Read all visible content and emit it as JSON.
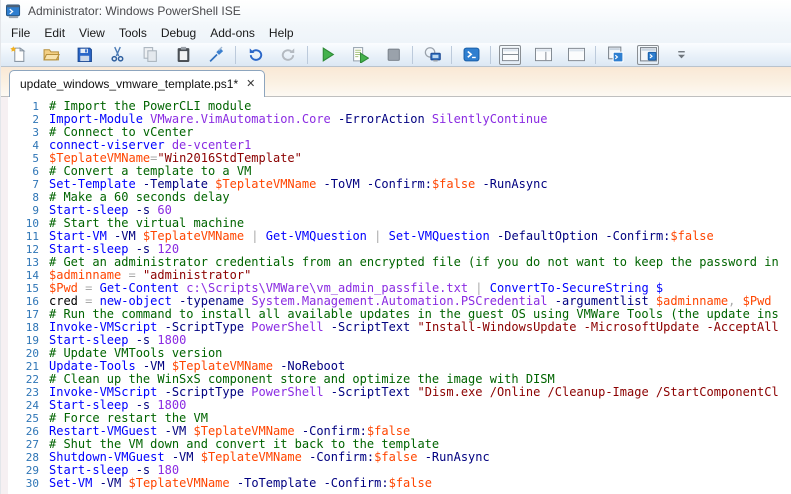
{
  "window": {
    "title": "Administrator: Windows PowerShell ISE"
  },
  "menu": {
    "items": [
      "File",
      "Edit",
      "View",
      "Tools",
      "Debug",
      "Add-ons",
      "Help"
    ]
  },
  "toolbar": {
    "buttons": [
      {
        "icon": "new-script-icon"
      },
      {
        "icon": "open-script-icon"
      },
      {
        "icon": "save-icon"
      },
      {
        "icon": "cut-icon"
      },
      {
        "icon": "copy-icon"
      },
      {
        "icon": "paste-icon"
      },
      {
        "icon": "clear-console-pane-icon"
      },
      {
        "separator": true
      },
      {
        "icon": "undo-icon"
      },
      {
        "icon": "redo-icon"
      },
      {
        "separator": true
      },
      {
        "icon": "run-script-icon"
      },
      {
        "icon": "run-selection-icon"
      },
      {
        "icon": "stop-operation-icon"
      },
      {
        "separator": true
      },
      {
        "icon": "new-remote-powershell-tab-icon"
      },
      {
        "separator": true
      },
      {
        "icon": "start-powershell-icon"
      },
      {
        "separator": true
      },
      {
        "icon": "show-script-pane-top-icon",
        "selected": true
      },
      {
        "icon": "show-script-pane-right-icon"
      },
      {
        "icon": "show-script-pane-maximized-icon"
      },
      {
        "separator": true
      },
      {
        "icon": "new-powershell-tab-icon"
      },
      {
        "icon": "show-script-pane-icon",
        "selected": true
      },
      {
        "icon": "toolbar-overflow-icon",
        "overflow": true
      }
    ]
  },
  "tab": {
    "label": "update_windows_vmware_template.ps1*",
    "close_glyph": "✕"
  },
  "editor": {
    "line_number_color": "#2E75B6",
    "token_colors": {
      "c": "#006400",
      "k": "#0000FF",
      "p": "#000080",
      "a": "#8A2BE2",
      "v": "#FF4500",
      "s": "#8B0000",
      "o": "#A9A9A9",
      "t": "#000000"
    },
    "lines": [
      {
        "n": 1,
        "t": [
          [
            "c",
            "# Import the PowerCLI module"
          ]
        ]
      },
      {
        "n": 2,
        "t": [
          [
            "k",
            "Import-Module"
          ],
          [
            "a",
            " VMware.VimAutomation.Core"
          ],
          [
            "p",
            " -ErrorAction"
          ],
          [
            "a",
            " SilentlyContinue"
          ]
        ]
      },
      {
        "n": 3,
        "t": [
          [
            "c",
            "# Connect to vCenter"
          ]
        ]
      },
      {
        "n": 4,
        "t": [
          [
            "k",
            "connect-viserver"
          ],
          [
            "a",
            " de-vcenter1"
          ]
        ]
      },
      {
        "n": 5,
        "t": [
          [
            "v",
            "$TeplateVMName"
          ],
          [
            "o",
            "="
          ],
          [
            "s",
            "\"Win2016StdTemplate\""
          ]
        ]
      },
      {
        "n": 6,
        "t": [
          [
            "c",
            "# Convert a template to a VM"
          ]
        ]
      },
      {
        "n": 7,
        "t": [
          [
            "k",
            "Set-Template"
          ],
          [
            "p",
            " -Template"
          ],
          [
            "v",
            " $TeplateVMName"
          ],
          [
            "p",
            " -ToVM"
          ],
          [
            "p",
            " -Confirm:"
          ],
          [
            "v",
            "$false"
          ],
          [
            "p",
            " -RunAsync"
          ]
        ]
      },
      {
        "n": 8,
        "t": [
          [
            "c",
            "# Make a 60 seconds delay"
          ]
        ]
      },
      {
        "n": 9,
        "t": [
          [
            "k",
            "Start-sleep"
          ],
          [
            "p",
            " -s"
          ],
          [
            "a",
            " 60"
          ]
        ]
      },
      {
        "n": 10,
        "t": [
          [
            "c",
            "# Start the virtual machine"
          ]
        ]
      },
      {
        "n": 11,
        "t": [
          [
            "k",
            "Start-VM"
          ],
          [
            "p",
            " -VM"
          ],
          [
            "v",
            " $TeplateVMName"
          ],
          [
            "o",
            " | "
          ],
          [
            "k",
            "Get-VMQuestion"
          ],
          [
            "o",
            " | "
          ],
          [
            "k",
            "Set-VMQuestion"
          ],
          [
            "p",
            " -DefaultOption"
          ],
          [
            "p",
            " -Confirm:"
          ],
          [
            "v",
            "$false"
          ]
        ]
      },
      {
        "n": 12,
        "t": [
          [
            "k",
            "Start-sleep"
          ],
          [
            "p",
            " -s"
          ],
          [
            "a",
            " 120"
          ]
        ]
      },
      {
        "n": 13,
        "t": [
          [
            "c",
            "# Get an administrator credentials from an encrypted file (if you do not want to keep the password in"
          ]
        ]
      },
      {
        "n": 14,
        "t": [
          [
            "v",
            "$adminname"
          ],
          [
            "o",
            " = "
          ],
          [
            "s",
            "\"administrator\""
          ]
        ]
      },
      {
        "n": 15,
        "t": [
          [
            "v",
            "$Pwd"
          ],
          [
            "o",
            " = "
          ],
          [
            "k",
            "Get-Content"
          ],
          [
            "a",
            " c:\\Scripts\\VMWare\\vm_admin_passfile.txt"
          ],
          [
            "o",
            " | "
          ],
          [
            "k",
            "ConvertTo-SecureString"
          ],
          [
            "k",
            " $"
          ]
        ]
      },
      {
        "n": 16,
        "t": [
          [
            "t",
            "cred"
          ],
          [
            "o",
            " = "
          ],
          [
            "k",
            "new-object"
          ],
          [
            "p",
            " -typename"
          ],
          [
            "a",
            " System.Management.Automation.PSCredential"
          ],
          [
            "p",
            " -argumentlist"
          ],
          [
            "v",
            " $adminname"
          ],
          [
            "o",
            ","
          ],
          [
            "v",
            " $Pwd"
          ]
        ]
      },
      {
        "n": 17,
        "t": [
          [
            "c",
            "# Run the command to install all available updates in the guest OS using VMWare Tools (the update ins"
          ]
        ]
      },
      {
        "n": 18,
        "t": [
          [
            "k",
            "Invoke-VMScript"
          ],
          [
            "p",
            " -ScriptType"
          ],
          [
            "a",
            " PowerShell"
          ],
          [
            "p",
            " -ScriptText"
          ],
          [
            "s",
            " \"Install-WindowsUpdate -MicrosoftUpdate -AcceptAll"
          ]
        ]
      },
      {
        "n": 19,
        "t": [
          [
            "k",
            "Start-sleep"
          ],
          [
            "p",
            " -s"
          ],
          [
            "a",
            " 1800"
          ]
        ]
      },
      {
        "n": 20,
        "t": [
          [
            "c",
            "# Update VMTools version"
          ]
        ]
      },
      {
        "n": 21,
        "t": [
          [
            "k",
            "Update-Tools"
          ],
          [
            "p",
            " -VM"
          ],
          [
            "v",
            " $TeplateVMName"
          ],
          [
            "p",
            " -NoReboot"
          ]
        ]
      },
      {
        "n": 22,
        "t": [
          [
            "c",
            "# Clean up the WinSxS component store and optimize the image with DISM"
          ]
        ]
      },
      {
        "n": 23,
        "t": [
          [
            "k",
            "Invoke-VMScript"
          ],
          [
            "p",
            " -ScriptType"
          ],
          [
            "a",
            " PowerShell"
          ],
          [
            "p",
            " -ScriptText"
          ],
          [
            "s",
            " \"Dism.exe /Online /Cleanup-Image /StartComponentCl"
          ]
        ]
      },
      {
        "n": 24,
        "t": [
          [
            "k",
            "Start-sleep"
          ],
          [
            "p",
            " -s"
          ],
          [
            "a",
            " 1800"
          ]
        ]
      },
      {
        "n": 25,
        "t": [
          [
            "c",
            "# Force restart the VM"
          ]
        ]
      },
      {
        "n": 26,
        "t": [
          [
            "k",
            "Restart-VMGuest"
          ],
          [
            "p",
            " -VM"
          ],
          [
            "v",
            " $TeplateVMName"
          ],
          [
            "p",
            " -Confirm:"
          ],
          [
            "v",
            "$false"
          ]
        ]
      },
      {
        "n": 27,
        "t": [
          [
            "c",
            "# Shut the VM down and convert it back to the template"
          ]
        ]
      },
      {
        "n": 28,
        "t": [
          [
            "k",
            "Shutdown-VMGuest"
          ],
          [
            "p",
            " -VM"
          ],
          [
            "v",
            " $TeplateVMName"
          ],
          [
            "p",
            " -Confirm:"
          ],
          [
            "v",
            "$false"
          ],
          [
            "p",
            " -RunAsync"
          ]
        ]
      },
      {
        "n": 29,
        "t": [
          [
            "k",
            "Start-sleep"
          ],
          [
            "p",
            " -s"
          ],
          [
            "a",
            " 180"
          ]
        ]
      },
      {
        "n": 30,
        "t": [
          [
            "k",
            "Set-VM"
          ],
          [
            "p",
            " -VM"
          ],
          [
            "v",
            " $TeplateVMName"
          ],
          [
            "p",
            " -ToTemplate"
          ],
          [
            "p",
            " -Confirm:"
          ],
          [
            "v",
            "$false"
          ]
        ]
      }
    ]
  }
}
